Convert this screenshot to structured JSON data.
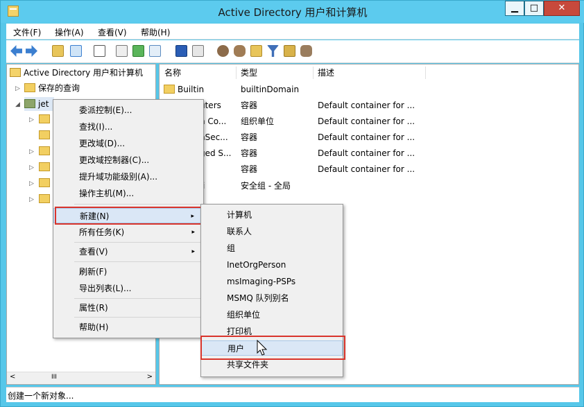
{
  "window": {
    "title": "Active Directory 用户和计算机",
    "min_label": "▁",
    "max_label": "□",
    "close_label": "✕"
  },
  "menubar": [
    {
      "label": "文件(F)"
    },
    {
      "label": "操作(A)"
    },
    {
      "label": "查看(V)"
    },
    {
      "label": "帮助(H)"
    }
  ],
  "toolbar": [
    "back-icon",
    "forward-icon",
    "up-folder-icon",
    "show-hide-tree-icon",
    "copy-icon",
    "properties-icon",
    "refresh-icon",
    "export-icon",
    "help-icon",
    "console-icon",
    "add-user-icon",
    "add-group-icon",
    "add-ou-icon",
    "filter-icon",
    "find-icon",
    "delegate-icon"
  ],
  "tree": {
    "root": "Active Directory 用户和计算机",
    "saved_queries": "保存的查询",
    "domain": "jet",
    "scroll_mid": "III"
  },
  "list": {
    "columns": [
      "名称",
      "类型",
      "描述"
    ],
    "rows": [
      {
        "name": "Builtin",
        "type": "builtinDomain",
        "desc": ""
      },
      {
        "name": "uters",
        "type": "容器",
        "desc": "Default container for ..."
      },
      {
        "name": "n Co...",
        "type": "组织单位",
        "desc": "Default container for ..."
      },
      {
        "name": "nSec...",
        "type": "容器",
        "desc": "Default container for ..."
      },
      {
        "name": "ged S...",
        "type": "容器",
        "desc": "Default container for ..."
      },
      {
        "name": "",
        "type": "容器",
        "desc": "Default container for ..."
      },
      {
        "name": "i",
        "type": "安全组 - 全局",
        "desc": ""
      }
    ]
  },
  "context_menu": {
    "items": [
      {
        "label": "委派控制(E)..."
      },
      {
        "label": "查找(I)..."
      },
      {
        "label": "更改域(D)..."
      },
      {
        "label": "更改域控制器(C)..."
      },
      {
        "label": "提升域功能级别(A)..."
      },
      {
        "label": "操作主机(M)..."
      },
      {
        "label": "新建(N)"
      },
      {
        "label": "所有任务(K)"
      },
      {
        "label": "查看(V)"
      },
      {
        "label": "刷新(F)"
      },
      {
        "label": "导出列表(L)..."
      },
      {
        "label": "属性(R)"
      },
      {
        "label": "帮助(H)"
      }
    ],
    "submenu_arrow": "▸"
  },
  "submenu": {
    "items": [
      {
        "label": "计算机"
      },
      {
        "label": "联系人"
      },
      {
        "label": "组"
      },
      {
        "label": "InetOrgPerson"
      },
      {
        "label": "msImaging-PSPs"
      },
      {
        "label": "MSMQ 队列别名"
      },
      {
        "label": "组织单位"
      },
      {
        "label": "打印机"
      },
      {
        "label": "用户"
      },
      {
        "label": "共享文件夹"
      }
    ]
  },
  "statusbar": {
    "text": "创建一个新对象..."
  },
  "colors": {
    "titlebar": "#5ccbee",
    "highlight_box": "#d9342b",
    "close": "#c7493c"
  }
}
